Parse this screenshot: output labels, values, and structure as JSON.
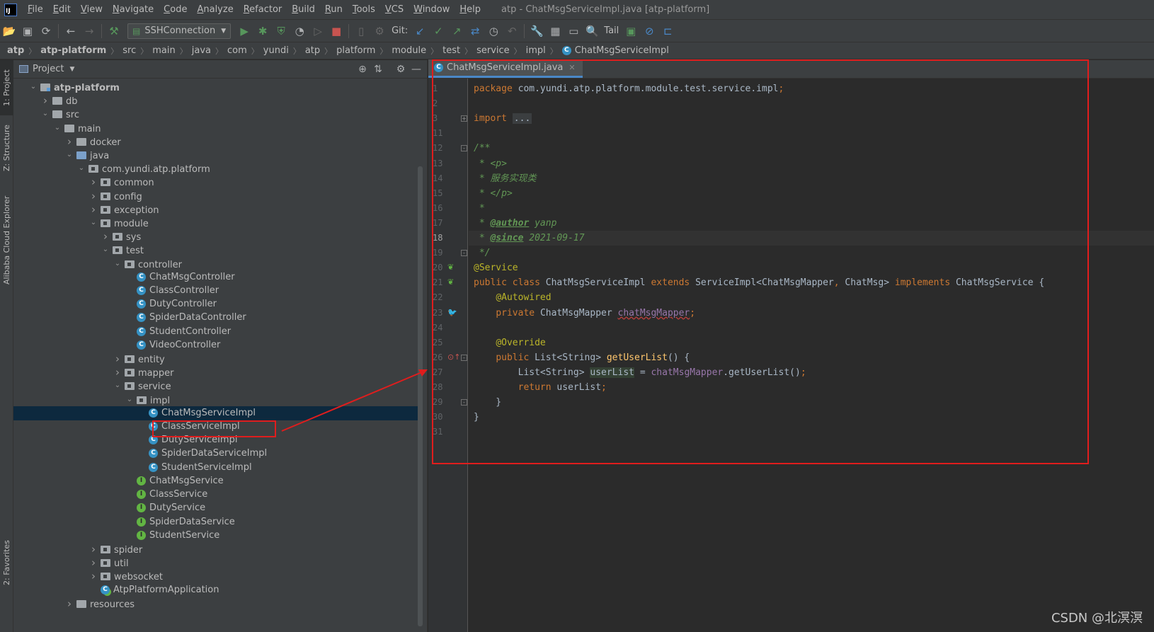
{
  "menubar": {
    "logo": "IJ",
    "items": [
      "File",
      "Edit",
      "View",
      "Navigate",
      "Code",
      "Analyze",
      "Refactor",
      "Build",
      "Run",
      "Tools",
      "VCS",
      "Window",
      "Help"
    ],
    "window_title": "atp - ChatMsgServiceImpl.java [atp-platform]"
  },
  "toolbar": {
    "run_config": "SSHConnection",
    "git_label": "Git:",
    "tail_label": "Tail"
  },
  "breadcrumb": [
    "atp",
    "atp-platform",
    "src",
    "main",
    "java",
    "com",
    "yundi",
    "atp",
    "platform",
    "module",
    "test",
    "service",
    "impl",
    "ChatMsgServiceImpl"
  ],
  "left_strip": {
    "project_tab": "1: Project",
    "structure_tab": "Z: Structure",
    "cloud_tab": "Alibaba Cloud Explorer",
    "favorites_tab": "2: Favorites"
  },
  "project_panel": {
    "title": "Project",
    "tree": [
      {
        "label": "atp-platform",
        "level": 0,
        "type": "module",
        "arrow": "down",
        "bold": true
      },
      {
        "label": "db",
        "level": 1,
        "type": "folder",
        "arrow": "right"
      },
      {
        "label": "src",
        "level": 1,
        "type": "folder",
        "arrow": "down"
      },
      {
        "label": "main",
        "level": 2,
        "type": "folder",
        "arrow": "down"
      },
      {
        "label": "docker",
        "level": 3,
        "type": "folder",
        "arrow": "right"
      },
      {
        "label": "java",
        "level": 3,
        "type": "src",
        "arrow": "down"
      },
      {
        "label": "com.yundi.atp.platform",
        "level": 4,
        "type": "pkg",
        "arrow": "down"
      },
      {
        "label": "common",
        "level": 5,
        "type": "pkg",
        "arrow": "right"
      },
      {
        "label": "config",
        "level": 5,
        "type": "pkg",
        "arrow": "right"
      },
      {
        "label": "exception",
        "level": 5,
        "type": "pkg",
        "arrow": "right"
      },
      {
        "label": "module",
        "level": 5,
        "type": "pkg",
        "arrow": "down"
      },
      {
        "label": "sys",
        "level": 6,
        "type": "pkg",
        "arrow": "right"
      },
      {
        "label": "test",
        "level": 6,
        "type": "pkg",
        "arrow": "down"
      },
      {
        "label": "controller",
        "level": 7,
        "type": "pkg",
        "arrow": "down"
      },
      {
        "label": "ChatMsgController",
        "level": 8,
        "type": "class",
        "arrow": ""
      },
      {
        "label": "ClassController",
        "level": 8,
        "type": "class",
        "arrow": ""
      },
      {
        "label": "DutyController",
        "level": 8,
        "type": "class",
        "arrow": ""
      },
      {
        "label": "SpiderDataController",
        "level": 8,
        "type": "class",
        "arrow": ""
      },
      {
        "label": "StudentController",
        "level": 8,
        "type": "class",
        "arrow": ""
      },
      {
        "label": "VideoController",
        "level": 8,
        "type": "class",
        "arrow": ""
      },
      {
        "label": "entity",
        "level": 7,
        "type": "pkg",
        "arrow": "right"
      },
      {
        "label": "mapper",
        "level": 7,
        "type": "pkg",
        "arrow": "right"
      },
      {
        "label": "service",
        "level": 7,
        "type": "pkg",
        "arrow": "down"
      },
      {
        "label": "impl",
        "level": 8,
        "type": "pkg",
        "arrow": "down"
      },
      {
        "label": "ChatMsgServiceImpl",
        "level": 9,
        "type": "class",
        "arrow": "",
        "selected": true
      },
      {
        "label": "ClassServiceImpl",
        "level": 9,
        "type": "class",
        "arrow": ""
      },
      {
        "label": "DutyServiceImpl",
        "level": 9,
        "type": "class",
        "arrow": ""
      },
      {
        "label": "SpiderDataServiceImpl",
        "level": 9,
        "type": "class",
        "arrow": ""
      },
      {
        "label": "StudentServiceImpl",
        "level": 9,
        "type": "class",
        "arrow": ""
      },
      {
        "label": "ChatMsgService",
        "level": 8,
        "type": "iface",
        "arrow": ""
      },
      {
        "label": "ClassService",
        "level": 8,
        "type": "iface",
        "arrow": ""
      },
      {
        "label": "DutyService",
        "level": 8,
        "type": "iface",
        "arrow": ""
      },
      {
        "label": "SpiderDataService",
        "level": 8,
        "type": "iface",
        "arrow": ""
      },
      {
        "label": "StudentService",
        "level": 8,
        "type": "iface",
        "arrow": ""
      },
      {
        "label": "spider",
        "level": 5,
        "type": "pkg",
        "arrow": "right"
      },
      {
        "label": "util",
        "level": 5,
        "type": "pkg",
        "arrow": "right"
      },
      {
        "label": "websocket",
        "level": 5,
        "type": "pkg",
        "arrow": "right"
      },
      {
        "label": "AtpPlatformApplication",
        "level": 5,
        "type": "app",
        "arrow": ""
      },
      {
        "label": "resources",
        "level": 3,
        "type": "folder",
        "arrow": "right"
      }
    ]
  },
  "editor": {
    "tab_label": "ChatMsgServiceImpl.java",
    "current_line": "18",
    "lines": [
      {
        "n": "1",
        "html": "<span class=\"kw\">package </span>com.yundi.atp.platform.module.test.service.impl<span class=\"kw\">;</span>"
      },
      {
        "n": "2",
        "html": ""
      },
      {
        "n": "3",
        "html": "<span class=\"kw\">import </span><span class=\"fold-box\">...</span>",
        "fold": "+"
      },
      {
        "n": "11",
        "html": ""
      },
      {
        "n": "12",
        "html": "<span class=\"doc\">/**</span>",
        "fold": "-"
      },
      {
        "n": "13",
        "html": "<span class=\"doc\"> * &lt;p&gt;</span>"
      },
      {
        "n": "14",
        "html": "<span class=\"doc\"> * 服务实现类</span>"
      },
      {
        "n": "15",
        "html": "<span class=\"doc\"> * &lt;/p&gt;</span>"
      },
      {
        "n": "16",
        "html": "<span class=\"doc\"> *</span>"
      },
      {
        "n": "17",
        "html": "<span class=\"doc\"> * </span><span class=\"doctag\">@author</span><span class=\"doc\"> yanp</span>"
      },
      {
        "n": "18",
        "html": "<span class=\"doc\"> * </span><span class=\"doctag\">@since</span><span class=\"doc\"> 2021-09-17</span>"
      },
      {
        "n": "19",
        "html": "<span class=\"doc\"> */</span>",
        "fold": "-"
      },
      {
        "n": "20",
        "html": "<span class=\"ann\">@Service</span>",
        "gicon": "bean"
      },
      {
        "n": "21",
        "html": "<span class=\"kw\">public class </span>ChatMsgServiceImpl <span class=\"kw\">extends </span>ServiceImpl&lt;ChatMsgMapper<span class=\"kw\">, </span>ChatMsg&gt; <span class=\"kw\">implements </span>ChatMsgService {",
        "gicon": "bean-impl"
      },
      {
        "n": "22",
        "html": "    <span class=\"ann\">@Autowired</span>"
      },
      {
        "n": "23",
        "html": "    <span class=\"kw\">private </span>ChatMsgMapper <span class=\"fld ul-warn\">chatMsgMapper</span><span class=\"kw\">;</span>",
        "gicon": "mapper"
      },
      {
        "n": "24",
        "html": ""
      },
      {
        "n": "25",
        "html": "    <span class=\"ann\">@Override</span>"
      },
      {
        "n": "26",
        "html": "    <span class=\"kw\">public </span>List&lt;String&gt; <span class=\"fn\">getUserList</span>() {",
        "gicon": "override",
        "fold": "-"
      },
      {
        "n": "27",
        "html": "        List&lt;String&gt; <span class=\"hl\">userList</span> = <span class=\"fld\">chatMsgMapper</span>.getUserList()<span class=\"kw\">;</span>"
      },
      {
        "n": "28",
        "html": "        <span class=\"kw\">return </span>userList<span class=\"kw\">;</span>"
      },
      {
        "n": "29",
        "html": "    }",
        "fold": "-"
      },
      {
        "n": "30",
        "html": "}"
      },
      {
        "n": "31",
        "html": ""
      }
    ]
  },
  "watermark": "CSDN @北溟溟",
  "colors": {
    "annotation_red": "#e01d1d",
    "accent_blue": "#4a88c7"
  }
}
